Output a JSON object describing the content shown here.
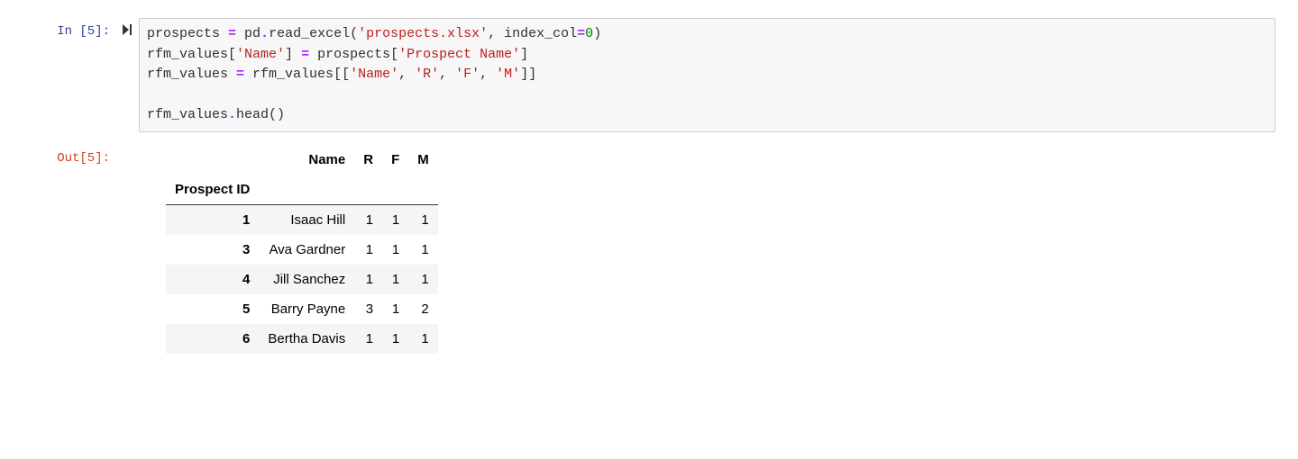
{
  "prompt": {
    "in_label": "In [5]:",
    "out_label": "Out[5]:"
  },
  "run_icon": "▶|",
  "code": {
    "line1_a": "prospects ",
    "line1_op": "=",
    "line1_b": " pd",
    "line1_d": "read_excel(",
    "line1_str": "'prospects.xlsx'",
    "line1_e": ", index_col",
    "line1_op2": "=",
    "line1_num": "0",
    "line1_f": ")",
    "line2_a": "rfm_values[",
    "line2_str1": "'Name'",
    "line2_b": "] ",
    "line2_op": "=",
    "line2_c": " prospects[",
    "line2_str2": "'Prospect Name'",
    "line2_d": "]",
    "line3_a": "rfm_values ",
    "line3_op": "=",
    "line3_b": " rfm_values[[",
    "line3_str1": "'Name'",
    "line3_c": ", ",
    "line3_str2": "'R'",
    "line3_d": ", ",
    "line3_str3": "'F'",
    "line3_e": ", ",
    "line3_str4": "'M'",
    "line3_f": "]]",
    "line4": "",
    "line5_a": "rfm_values",
    "line5_b": "head()"
  },
  "table": {
    "index_name": "Prospect ID",
    "columns": [
      "Name",
      "R",
      "F",
      "M"
    ],
    "rows": [
      {
        "id": "1",
        "name": "Isaac Hill",
        "r": "1",
        "f": "1",
        "m": "1"
      },
      {
        "id": "3",
        "name": "Ava Gardner",
        "r": "1",
        "f": "1",
        "m": "1"
      },
      {
        "id": "4",
        "name": "Jill Sanchez",
        "r": "1",
        "f": "1",
        "m": "1"
      },
      {
        "id": "5",
        "name": "Barry Payne",
        "r": "3",
        "f": "1",
        "m": "2"
      },
      {
        "id": "6",
        "name": "Bertha Davis",
        "r": "1",
        "f": "1",
        "m": "1"
      }
    ]
  }
}
